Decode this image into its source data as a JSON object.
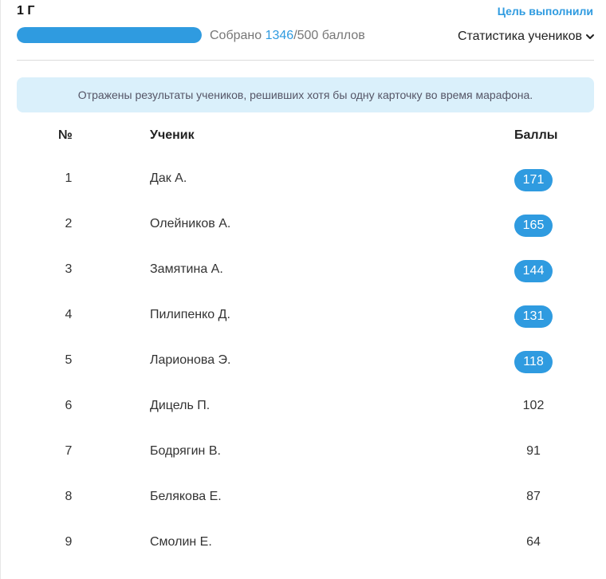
{
  "header": {
    "class_name": "1 Г",
    "goal_link": "Цель выполнили",
    "progress": {
      "label_prefix": "Собрано ",
      "current": "1346",
      "separator_total": "/500 баллов",
      "fill_fraction": 1.0
    },
    "stats_dropdown": "Статистика учеников"
  },
  "banner": "Отражены результаты учеников, решивших хотя бы одну карточку во время марафона.",
  "table": {
    "columns": [
      "№",
      "Ученик",
      "Баллы"
    ],
    "rows": [
      {
        "num": "1",
        "name": "Дак А.",
        "score": "171",
        "highlight": true
      },
      {
        "num": "2",
        "name": "Олейников А.",
        "score": "165",
        "highlight": true
      },
      {
        "num": "3",
        "name": "Замятина А.",
        "score": "144",
        "highlight": true
      },
      {
        "num": "4",
        "name": "Пилипенко Д.",
        "score": "131",
        "highlight": true
      },
      {
        "num": "5",
        "name": "Ларионова Э.",
        "score": "118",
        "highlight": true
      },
      {
        "num": "6",
        "name": "Дицель П.",
        "score": "102",
        "highlight": false
      },
      {
        "num": "7",
        "name": "Бодрягин В.",
        "score": "91",
        "highlight": false
      },
      {
        "num": "8",
        "name": "Белякова Е.",
        "score": "87",
        "highlight": false
      },
      {
        "num": "9",
        "name": "Смолин Е.",
        "score": "64",
        "highlight": false
      }
    ]
  },
  "colors": {
    "accent": "#2f9be0",
    "banner_bg": "#daf0fb"
  }
}
